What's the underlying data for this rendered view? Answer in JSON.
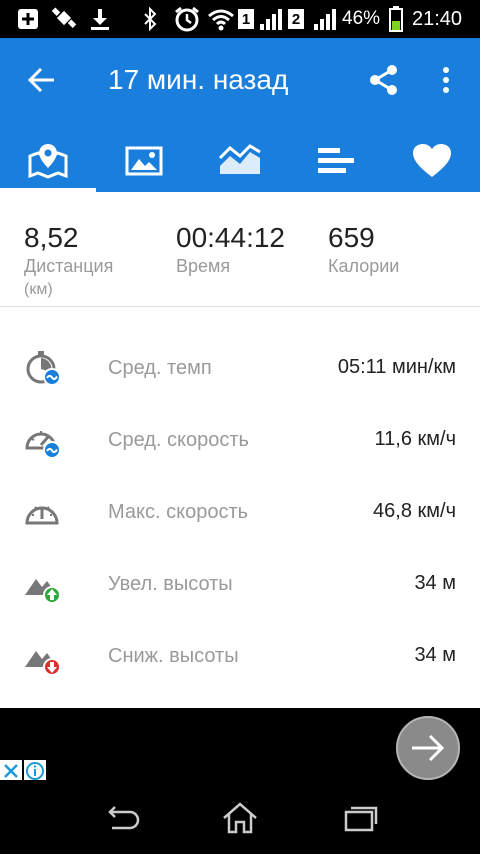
{
  "status_bar": {
    "sim1": "1",
    "sim2": "2",
    "battery_percent": "46%",
    "battery_level": 0.46,
    "time": "21:40"
  },
  "app_bar": {
    "title": "17 мин. назад"
  },
  "tabs": [
    {
      "name": "map-tab-icon",
      "active": true
    },
    {
      "name": "photo-tab-icon",
      "active": false
    },
    {
      "name": "chart-tab-icon",
      "active": false
    },
    {
      "name": "splits-tab-icon",
      "active": false
    },
    {
      "name": "heart-tab-icon",
      "active": false
    }
  ],
  "summary": {
    "distance": {
      "value": "8,52",
      "label": "Дистанция",
      "unit": "(км)"
    },
    "time": {
      "value": "00:44:12",
      "label": "Время"
    },
    "calories": {
      "value": "659",
      "label": "Калории"
    }
  },
  "stats": [
    {
      "icon": "avg-pace-icon",
      "label": "Сред. темп",
      "value": "05:11 мин/км"
    },
    {
      "icon": "avg-speed-icon",
      "label": "Сред. скорость",
      "value": "11,6 км/ч"
    },
    {
      "icon": "max-speed-icon",
      "label": "Макс. скорость",
      "value": "46,8 км/ч"
    },
    {
      "icon": "elevation-gain-icon",
      "label": "Увел. высоты",
      "value": "34 м"
    },
    {
      "icon": "elevation-loss-icon",
      "label": "Сниж. высоты",
      "value": "34 м"
    }
  ],
  "colors": {
    "primary": "#1a7fdc",
    "gain_arrow": "#2eaa3c",
    "loss_arrow": "#d9302c",
    "speed_badge": "#1a7fdc"
  }
}
